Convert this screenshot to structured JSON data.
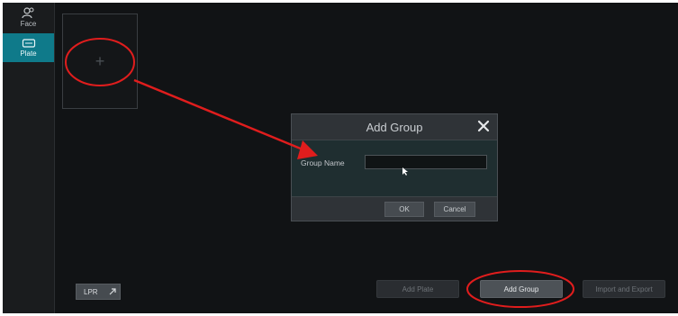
{
  "sidebar": {
    "items": [
      {
        "label": "Face",
        "icon": "face-icon"
      },
      {
        "label": "Plate",
        "icon": "plate-icon"
      }
    ]
  },
  "add_card": {
    "plus": "+"
  },
  "bottom": {
    "lpr_label": "LPR",
    "add_plate_label": "Add Plate",
    "add_group_label": "Add Group",
    "import_export_label": "Import and Export"
  },
  "dialog": {
    "title": "Add Group",
    "group_name_label": "Group Name",
    "group_name_value": "",
    "ok_label": "OK",
    "cancel_label": "Cancel"
  },
  "colors": {
    "accent": "#0f7a8a",
    "annotation": "#e01d1d"
  }
}
